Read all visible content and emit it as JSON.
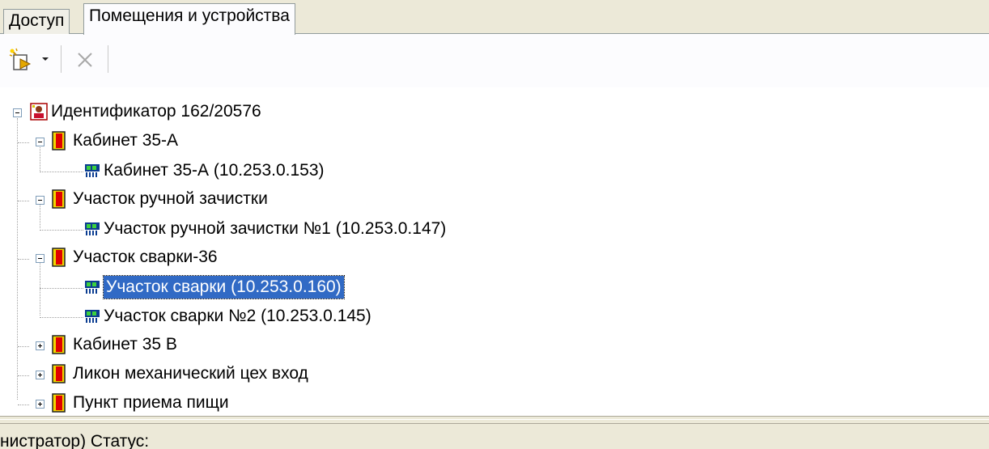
{
  "tabs": [
    {
      "label": "Доступ",
      "active": false
    },
    {
      "label": "Помещения и устройства",
      "active": true
    }
  ],
  "toolbar": {
    "new_icon": "new-item-wand-icon",
    "delete_icon": "delete-x-icon"
  },
  "tree": {
    "root": {
      "label": "Идентификатор 162/20576",
      "icon": "identifier-card-icon"
    },
    "rooms": [
      {
        "label": "Кабинет 35-А",
        "expanded": true,
        "devices": [
          {
            "label": "Кабинет 35-А (10.253.0.153)"
          }
        ]
      },
      {
        "label": "Участок ручной зачистки",
        "expanded": true,
        "devices": [
          {
            "label": "Участок ручной зачистки №1 (10.253.0.147)"
          }
        ]
      },
      {
        "label": "Участок сварки-36",
        "expanded": true,
        "devices": [
          {
            "label": "Участок сварки (10.253.0.160)",
            "selected": true
          },
          {
            "label": "Участок сварки №2 (10.253.0.145)"
          }
        ]
      },
      {
        "label": "Кабинет 35 В",
        "expanded": false,
        "devices": []
      },
      {
        "label": "Ликон механический цех вход",
        "expanded": false,
        "devices": []
      },
      {
        "label": "Пункт приема пищи",
        "expanded": false,
        "devices": []
      }
    ]
  },
  "status": {
    "text": "нистратор) Статус:"
  },
  "colors": {
    "selection": "#316ac5",
    "panel": "#ece9d8",
    "door": "#f2d600"
  }
}
